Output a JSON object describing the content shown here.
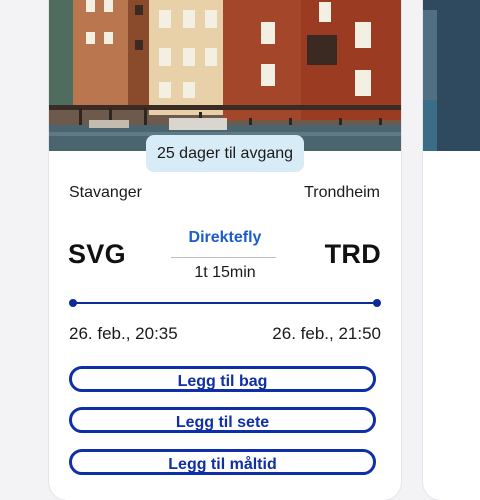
{
  "trip": {
    "countdown": "25 dager til avgang",
    "origin": {
      "city": "Stavanger",
      "code": "SVG",
      "departure": "26. feb., 20:35"
    },
    "destination": {
      "city": "Trondheim",
      "code": "TRD",
      "arrival": "26. feb., 21:50"
    },
    "flight_type": "Direktefly",
    "duration": "1t 15min"
  },
  "addons": {
    "bag_label": "Legg til bag",
    "seat_label": "Legg til sete",
    "meal_label": "Legg til måltid"
  },
  "colors": {
    "accent": "#0f2fa8",
    "link": "#1a5bcf",
    "badge_bg": "#d8ecf7"
  }
}
